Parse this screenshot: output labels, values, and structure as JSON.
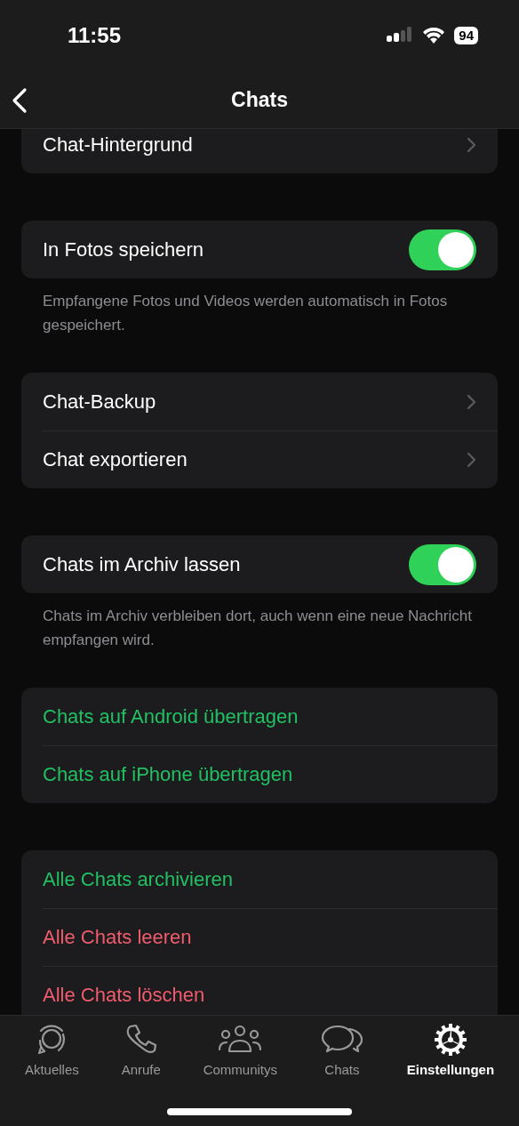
{
  "status_bar": {
    "time": "11:55",
    "battery": "94"
  },
  "nav": {
    "title": "Chats"
  },
  "groups": [
    {
      "rows": [
        {
          "kind": "chevron",
          "label": "Chat-Hintergrund"
        }
      ]
    },
    {
      "rows": [
        {
          "kind": "toggle",
          "label": "In Fotos speichern",
          "on": true
        }
      ],
      "footer": "Empfangene Fotos und Videos werden automatisch in Fotos gespeichert."
    },
    {
      "rows": [
        {
          "kind": "chevron",
          "label": "Chat-Backup"
        },
        {
          "kind": "chevron",
          "label": "Chat exportieren"
        }
      ]
    },
    {
      "rows": [
        {
          "kind": "toggle",
          "label": "Chats im Archiv lassen",
          "on": true
        }
      ],
      "footer": "Chats im Archiv verbleiben dort, auch wenn eine neue Nachricht empfangen wird."
    },
    {
      "rows": [
        {
          "kind": "action",
          "label": "Chats auf Android übertragen",
          "color": "#21c063"
        },
        {
          "kind": "action",
          "label": "Chats auf iPhone übertragen",
          "color": "#21c063"
        }
      ]
    },
    {
      "rows": [
        {
          "kind": "action",
          "label": "Alle Chats archivieren",
          "color": "#21c063"
        },
        {
          "kind": "action",
          "label": "Alle Chats leeren",
          "color": "#f15c6d"
        },
        {
          "kind": "action",
          "label": "Alle Chats löschen",
          "color": "#f15c6d"
        }
      ]
    }
  ],
  "tabs": [
    {
      "kind": "status",
      "label": "Aktuelles",
      "selected": false
    },
    {
      "kind": "phone",
      "label": "Anrufe",
      "selected": false
    },
    {
      "kind": "community",
      "label": "Communitys",
      "selected": false
    },
    {
      "kind": "chats",
      "label": "Chats",
      "selected": false
    },
    {
      "kind": "settings",
      "label": "Einstellungen",
      "selected": true
    }
  ]
}
